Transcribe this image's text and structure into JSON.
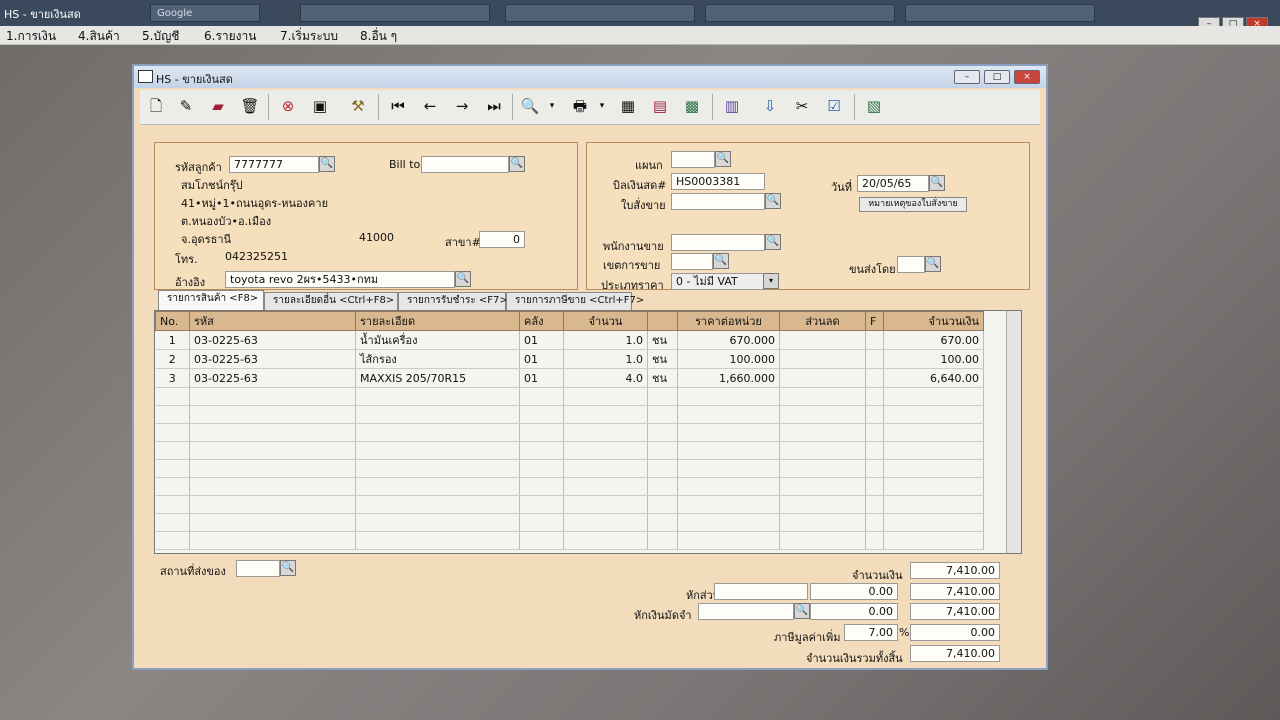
{
  "taskbar": {
    "app_title": "HS - ขายเงินสด",
    "tabs": [
      "Google",
      "",
      "",
      "",
      "",
      ""
    ]
  },
  "menu": [
    "1.การเงิน",
    "4.สินค้า",
    "5.บัญชี",
    "6.รายงาน",
    "7.เริ่มระบบ",
    "8.อื่น ๆ"
  ],
  "window": {
    "title": "HS - ขายเงินสด"
  },
  "customer": {
    "code_label": "รหัสลูกค้า",
    "code": "7777777",
    "billto_label": "Bill to",
    "billto": "",
    "name": "สมโภชน์กรุ๊ป",
    "address1": "41•หมู่•1•ถนนอุดร-หนองคาย",
    "address2": "ต.หนองบัว•อ.เมือง",
    "address3": "จ.อุดรธานี",
    "postcode": "41000",
    "branch_label": "สาขา#",
    "branch": "0",
    "phone_label": "โทร.",
    "phone": "042325251",
    "ref_label": "อ้างอิง",
    "ref": "toyota revo 2ผร•5433•กทม"
  },
  "doc": {
    "dept_label": "แผนก",
    "dept": "",
    "bill_label": "บิลเงินสด#",
    "bill": "HS0003381",
    "date_label": "วันที่",
    "date": "20/05/65",
    "order_label": "ใบสั่งขาย",
    "order": "",
    "note_button": "หมายเหตุของใบสั่งขาย",
    "salesman_label": "พนักงานขาย",
    "salesman": "",
    "zone_label": "เขตการขาย",
    "zone": "",
    "ship_label": "ขนส่งโดย",
    "ship": "",
    "pricetype_label": "ประเภทราคา",
    "pricetype": "0 - ไม่มี VAT"
  },
  "tabs": [
    "รายการสินค้า <F8>",
    "รายละเอียดอื่น <Ctrl+F8>",
    "รายการรับชำระ <F7>",
    "รายการภาษีขาย <Ctrl+F7>"
  ],
  "grid": {
    "headers": [
      "No.",
      "รหัส",
      "รายละเอียด",
      "คลัง",
      "จำนวน",
      "",
      "ราคาต่อหน่วย",
      "ส่วนลด",
      "F",
      "จำนวนเงิน"
    ],
    "rows": [
      [
        "1",
        "03-0225-63",
        "น้ำมันเครื่อง",
        "01",
        "1.0",
        "ชน",
        "670.000",
        "",
        "",
        "670.00"
      ],
      [
        "2",
        "03-0225-63",
        "ไส้กรอง",
        "01",
        "1.0",
        "ชน",
        "100.000",
        "",
        "",
        "100.00"
      ],
      [
        "3",
        "03-0225-63",
        "MAXXIS 205/70R15",
        "01",
        "4.0",
        "ชน",
        "1,660.000",
        "",
        "",
        "6,640.00"
      ]
    ]
  },
  "footer": {
    "place_label": "สถานที่ส่งของ",
    "place": "",
    "amount_label": "จำนวนเงิน",
    "amount": "7,410.00",
    "discount_label": "หักส่วนลด",
    "discount_text": "",
    "discount_value": "0.00",
    "after_discount": "7,410.00",
    "deposit_label": "หักเงินมัดจำ",
    "deposit_text": "",
    "deposit_value": "0.00",
    "after_deposit": "7,410.00",
    "vat_label": "ภาษีมูลค่าเพิ่ม",
    "vat_rate": "7.00",
    "vat_pct": "%",
    "vat_amount": "0.00",
    "grand_label": "จำนวนเงินรวมทั้งสิ้น",
    "grand": "7,410.00"
  }
}
